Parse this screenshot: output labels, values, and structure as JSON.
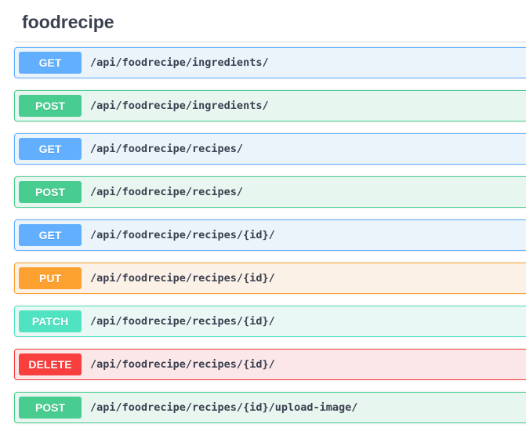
{
  "tag": {
    "title": "foodrecipe"
  },
  "methods": {
    "GET": {
      "label": "GET",
      "badge": "#61affe",
      "border": "#61affe",
      "bg": "#ebf3fb"
    },
    "POST": {
      "label": "POST",
      "badge": "#49cc90",
      "border": "#49cc90",
      "bg": "#e8f6f0"
    },
    "PUT": {
      "label": "PUT",
      "badge": "#fca130",
      "border": "#fca130",
      "bg": "#fbf1e6"
    },
    "PATCH": {
      "label": "PATCH",
      "badge": "#50e3c2",
      "border": "#50e3c2",
      "bg": "#e9f8f5"
    },
    "DELETE": {
      "label": "DELETE",
      "badge": "#f93e3e",
      "border": "#f93e3e",
      "bg": "#fbe7e7"
    }
  },
  "operations": [
    {
      "method": "GET",
      "path": "/api/foodrecipe/ingredients/"
    },
    {
      "method": "POST",
      "path": "/api/foodrecipe/ingredients/"
    },
    {
      "method": "GET",
      "path": "/api/foodrecipe/recipes/"
    },
    {
      "method": "POST",
      "path": "/api/foodrecipe/recipes/"
    },
    {
      "method": "GET",
      "path": "/api/foodrecipe/recipes/{id}/"
    },
    {
      "method": "PUT",
      "path": "/api/foodrecipe/recipes/{id}/"
    },
    {
      "method": "PATCH",
      "path": "/api/foodrecipe/recipes/{id}/"
    },
    {
      "method": "DELETE",
      "path": "/api/foodrecipe/recipes/{id}/"
    },
    {
      "method": "POST",
      "path": "/api/foodrecipe/recipes/{id}/upload-image/"
    }
  ]
}
